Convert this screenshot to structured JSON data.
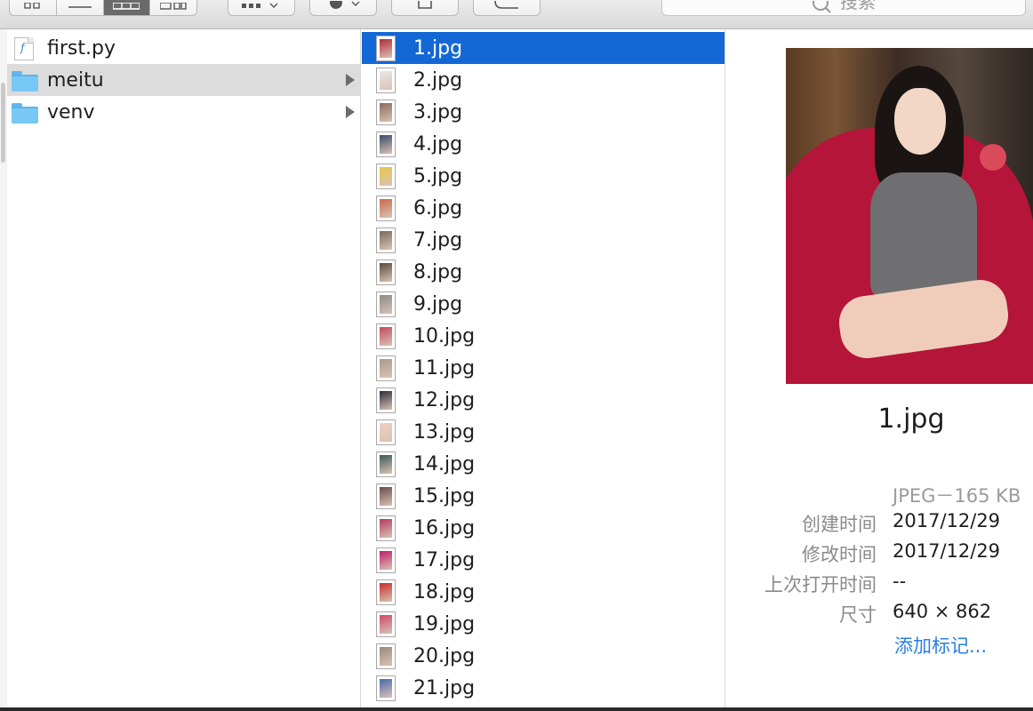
{
  "toolbar": {
    "view_modes": [
      "icon-view",
      "list-view",
      "column-view",
      "cover-flow-view"
    ],
    "active_view": 2,
    "search_placeholder": "搜索"
  },
  "column1": {
    "items": [
      {
        "name": "first.py",
        "type": "file",
        "selected": false,
        "has_children": false
      },
      {
        "name": "meitu",
        "type": "folder",
        "selected": true,
        "has_children": true
      },
      {
        "name": "venv",
        "type": "folder",
        "selected": false,
        "has_children": true
      }
    ]
  },
  "column2": {
    "items": [
      {
        "name": "1.jpg",
        "selected": true,
        "thumb_color": "#b22a3a"
      },
      {
        "name": "2.jpg",
        "selected": false,
        "thumb_color": "#e8e8e8"
      },
      {
        "name": "3.jpg",
        "selected": false,
        "thumb_color": "#8a6a5a"
      },
      {
        "name": "4.jpg",
        "selected": false,
        "thumb_color": "#3a4a6a"
      },
      {
        "name": "5.jpg",
        "selected": false,
        "thumb_color": "#e6c84a"
      },
      {
        "name": "6.jpg",
        "selected": false,
        "thumb_color": "#c86a4a"
      },
      {
        "name": "7.jpg",
        "selected": false,
        "thumb_color": "#7a6a5a"
      },
      {
        "name": "8.jpg",
        "selected": false,
        "thumb_color": "#5a4a3a"
      },
      {
        "name": "9.jpg",
        "selected": false,
        "thumb_color": "#8a8a8a"
      },
      {
        "name": "10.jpg",
        "selected": false,
        "thumb_color": "#c24a5a"
      },
      {
        "name": "11.jpg",
        "selected": false,
        "thumb_color": "#a89a8a"
      },
      {
        "name": "12.jpg",
        "selected": false,
        "thumb_color": "#2a2a3a"
      },
      {
        "name": "13.jpg",
        "selected": false,
        "thumb_color": "#f0d0c0"
      },
      {
        "name": "14.jpg",
        "selected": false,
        "thumb_color": "#3a5a5a"
      },
      {
        "name": "15.jpg",
        "selected": false,
        "thumb_color": "#6a4a4a"
      },
      {
        "name": "16.jpg",
        "selected": false,
        "thumb_color": "#b03a5a"
      },
      {
        "name": "17.jpg",
        "selected": false,
        "thumb_color": "#c21a6a"
      },
      {
        "name": "18.jpg",
        "selected": false,
        "thumb_color": "#c82a2a"
      },
      {
        "name": "19.jpg",
        "selected": false,
        "thumb_color": "#d04a6a"
      },
      {
        "name": "20.jpg",
        "selected": false,
        "thumb_color": "#9a8a7a"
      },
      {
        "name": "21.jpg",
        "selected": false,
        "thumb_color": "#4a6aaa"
      }
    ]
  },
  "preview": {
    "filename": "1.jpg",
    "kind": "JPEG－165 KB",
    "created_label": "创建时间",
    "created_value": "2017/12/29",
    "modified_label": "修改时间",
    "modified_value": "2017/12/29",
    "opened_label": "上次打开时间",
    "opened_value": "--",
    "size_label": "尺寸",
    "size_value": "640 × 862",
    "add_tags": "添加标记..."
  }
}
